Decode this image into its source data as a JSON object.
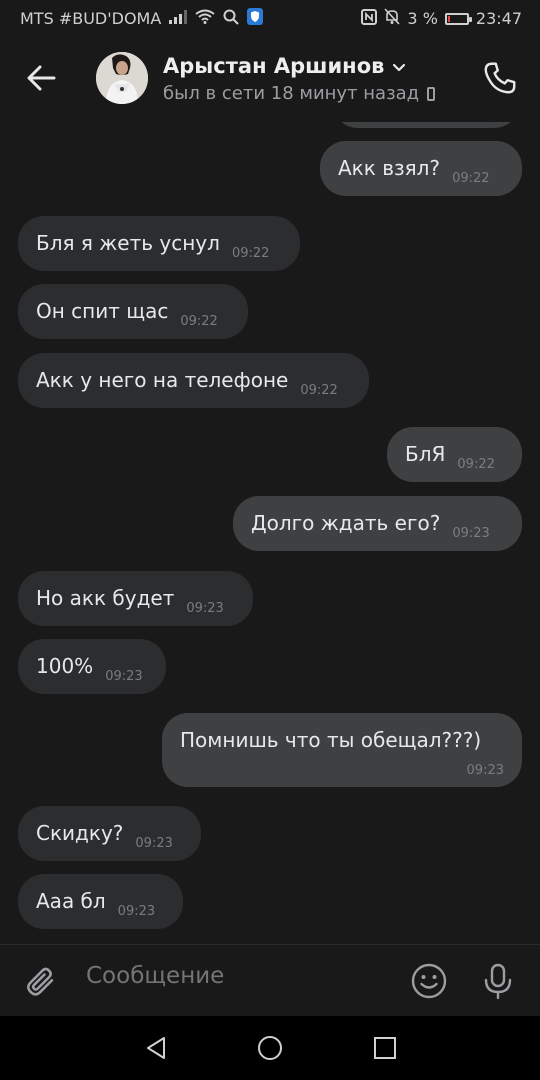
{
  "status_bar": {
    "carrier": "MTS #BUD'DOMA",
    "battery_percent": "3 %",
    "time": "23:47",
    "battery_level": 0.03,
    "icons": [
      "signal-icon",
      "wifi-icon",
      "search-icon",
      "shield-icon",
      "nfc-icon",
      "mute-icon",
      "battery-icon"
    ]
  },
  "header": {
    "contact_name": "Арыстан Аршинов",
    "status": "был в сети 18 минут назад",
    "icons": [
      "back-arrow-icon",
      "avatar",
      "chevron-down-icon",
      "mobile-device-icon",
      "phone-icon"
    ]
  },
  "messages": [
    {
      "dir": "in",
      "text": "Бля я жеть уснул",
      "time": "09:22"
    },
    {
      "dir": "in",
      "text": "Он спит щас",
      "time": "09:22"
    },
    {
      "dir": "in",
      "text": "Акк у него на телефоне",
      "time": "09:22"
    },
    {
      "dir": "out",
      "text": "БлЯ",
      "time": "09:22"
    },
    {
      "dir": "out",
      "text": "Долго ждать его?",
      "time": "09:23"
    },
    {
      "dir": "in",
      "text": "Но акк будет",
      "time": "09:23"
    },
    {
      "dir": "in",
      "text": "100%",
      "time": "09:23"
    },
    {
      "dir": "out",
      "text": "Помнишь что ты обещал???)",
      "time": "09:23"
    },
    {
      "dir": "in",
      "text": "Скидку?",
      "time": "09:23"
    },
    {
      "dir": "in",
      "text": "Ааа бл",
      "time": "09:23"
    }
  ],
  "prev_message": {
    "dir": "out",
    "text": "Акк взял?",
    "time": "09:22"
  },
  "composer": {
    "placeholder": "Сообщение",
    "icons": [
      "paperclip-icon",
      "emoji-icon",
      "microphone-icon"
    ]
  },
  "nav_bar": {
    "icons": [
      "nav-back-icon",
      "nav-home-icon",
      "nav-recents-icon"
    ]
  },
  "colors": {
    "background": "#19191a",
    "bubble_incoming": "#2c2d2f",
    "bubble_outgoing": "#3f4042",
    "time_text": "#7b7c80",
    "status_text": "#9d9ea2"
  }
}
